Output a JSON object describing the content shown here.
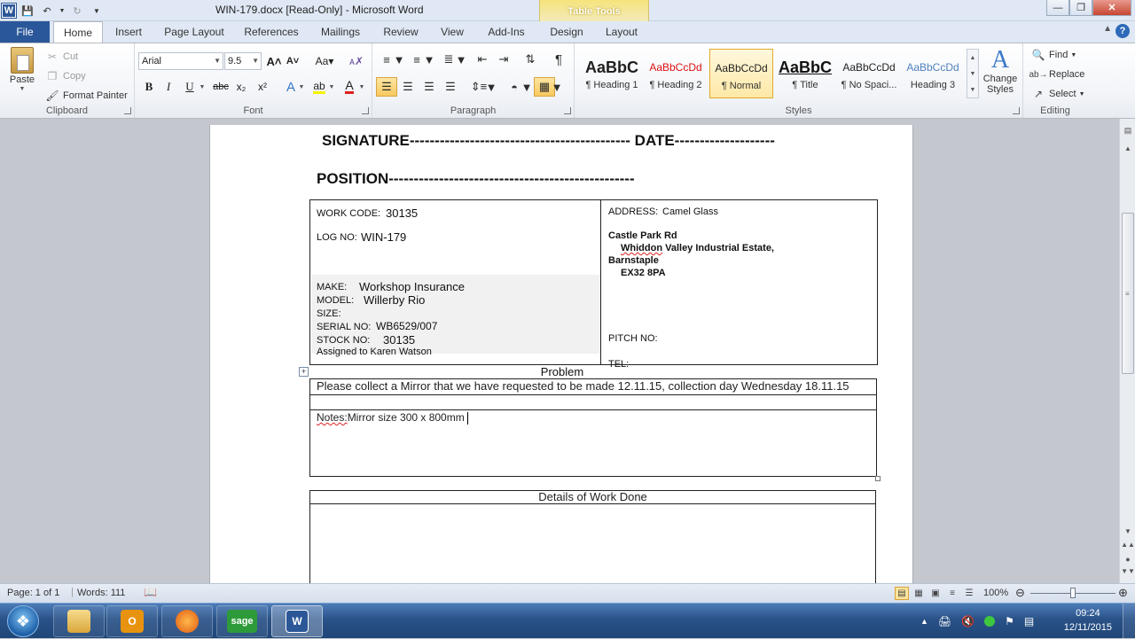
{
  "titlebar": {
    "title": "WIN-179.docx [Read-Only] - Microsoft Word",
    "context_tab_group": "Table Tools"
  },
  "tabs": [
    "File",
    "Home",
    "Insert",
    "Page Layout",
    "References",
    "Mailings",
    "Review",
    "View",
    "Add-Ins",
    "Design",
    "Layout"
  ],
  "clipboard": {
    "paste": "Paste",
    "cut": "Cut",
    "copy": "Copy",
    "format_painter": "Format Painter",
    "label": "Clipboard"
  },
  "font": {
    "name": "Arial",
    "size": "9.5",
    "label": "Font"
  },
  "paragraph": {
    "label": "Paragraph"
  },
  "styles": {
    "label": "Styles",
    "items": [
      {
        "sample": "AaBbC",
        "name": "¶ Heading 1"
      },
      {
        "sample": "AaBbCcDd",
        "name": "¶ Heading 2"
      },
      {
        "sample": "AaBbCcDd",
        "name": "¶ Normal"
      },
      {
        "sample": "AaBbC",
        "name": "¶ Title"
      },
      {
        "sample": "AaBbCcDd",
        "name": "¶ No Spaci..."
      },
      {
        "sample": "AaBbCcDd",
        "name": "Heading 3"
      }
    ],
    "change_styles": "Change Styles"
  },
  "editing": {
    "label": "Editing",
    "find": "Find",
    "replace": "Replace",
    "select": "Select"
  },
  "document": {
    "signature_line": "SIGNATURE-------------------------------------------- DATE--------------------",
    "position_line": "POSITION-------------------------------------------------",
    "work_code_label": "WORK CODE:",
    "work_code": "30135",
    "log_no_label": "LOG NO:",
    "log_no": "WIN-179",
    "make_label": "MAKE:",
    "make": "Workshop Insurance",
    "model_label": "MODEL:",
    "model": "Willerby Rio",
    "size_label": "SIZE:",
    "serial_label": "SERIAL  NO:",
    "serial": "WB6529/007",
    "stock_label": "STOCK NO:",
    "stock": "30135",
    "assigned": "Assigned to Karen Watson",
    "address_label": "ADDRESS:",
    "address_name": "Camel Glass",
    "address_line1": "Castle Park Rd",
    "address_line2_a": "Whiddon",
    "address_line2_b": " Valley Industrial Estate,",
    "address_line3": "Barnstaple",
    "address_line4": "EX32 8PA",
    "pitch_label": "PITCH NO:",
    "tel_label": "TEL:",
    "problem_header": "Problem",
    "problem_text": "Please collect a Mirror that we have requested to be made 12.11.15, collection day Wednesday 18.11.15",
    "notes_label": "Notes:",
    "notes_text": "Mirror size 300 x 800mm",
    "details_header": "Details of Work Done"
  },
  "status": {
    "page": "Page: 1 of 1",
    "words": "Words: 111",
    "zoom": "100%"
  },
  "taskbar": {
    "time": "09:24",
    "date": "12/11/2015"
  }
}
